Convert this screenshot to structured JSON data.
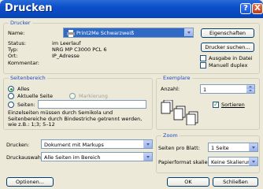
{
  "window": {
    "title": "Drucken",
    "help": "?",
    "close": "X"
  },
  "printer": {
    "legend": "Drucker",
    "name_label": "Name:",
    "name_value": "Print2Me Schwarzweiß",
    "status_label": "Status:",
    "status_value": "im Leerlauf",
    "type_label": "Typ:",
    "type_value": "NRG MP C3000 PCL 6",
    "location_label": "Ort:",
    "location_value": "IP_Adresse",
    "comment_label": "Kommentar:",
    "properties_button": "Eigenschaften",
    "find_button": "Drucker suchen...",
    "print_to_file": "Ausgabe in Datei",
    "manual_duplex": "Manuell duplex"
  },
  "range": {
    "legend": "Seitenbereich",
    "all": "Alles",
    "current": "Aktuelle Seite",
    "selection": "Markierung",
    "pages": "Seiten:",
    "hint": "Einzelseiten müssen durch Semikola und Seitenbereiche durch Bindestriche getrennt werden, wie z.B.: 1;3; 5–12"
  },
  "copies": {
    "legend": "Exemplare",
    "count_label": "Anzahl:",
    "count_value": "1",
    "collate": "Sortieren"
  },
  "print_what": {
    "label": "Drucken:",
    "value": "Dokument mit Markups"
  },
  "print_selection": {
    "label": "Druckauswahl:",
    "value": "Alle Seiten im Bereich"
  },
  "zoom": {
    "legend": "Zoom",
    "pages_per_sheet_label": "Seiten pro Blatt:",
    "pages_per_sheet_value": "1 Seite",
    "scale_label": "Papierformat skalieren:",
    "scale_value": "Keine Skalierung"
  },
  "buttons": {
    "options": "Optionen...",
    "ok": "OK",
    "close": "Schließen"
  }
}
